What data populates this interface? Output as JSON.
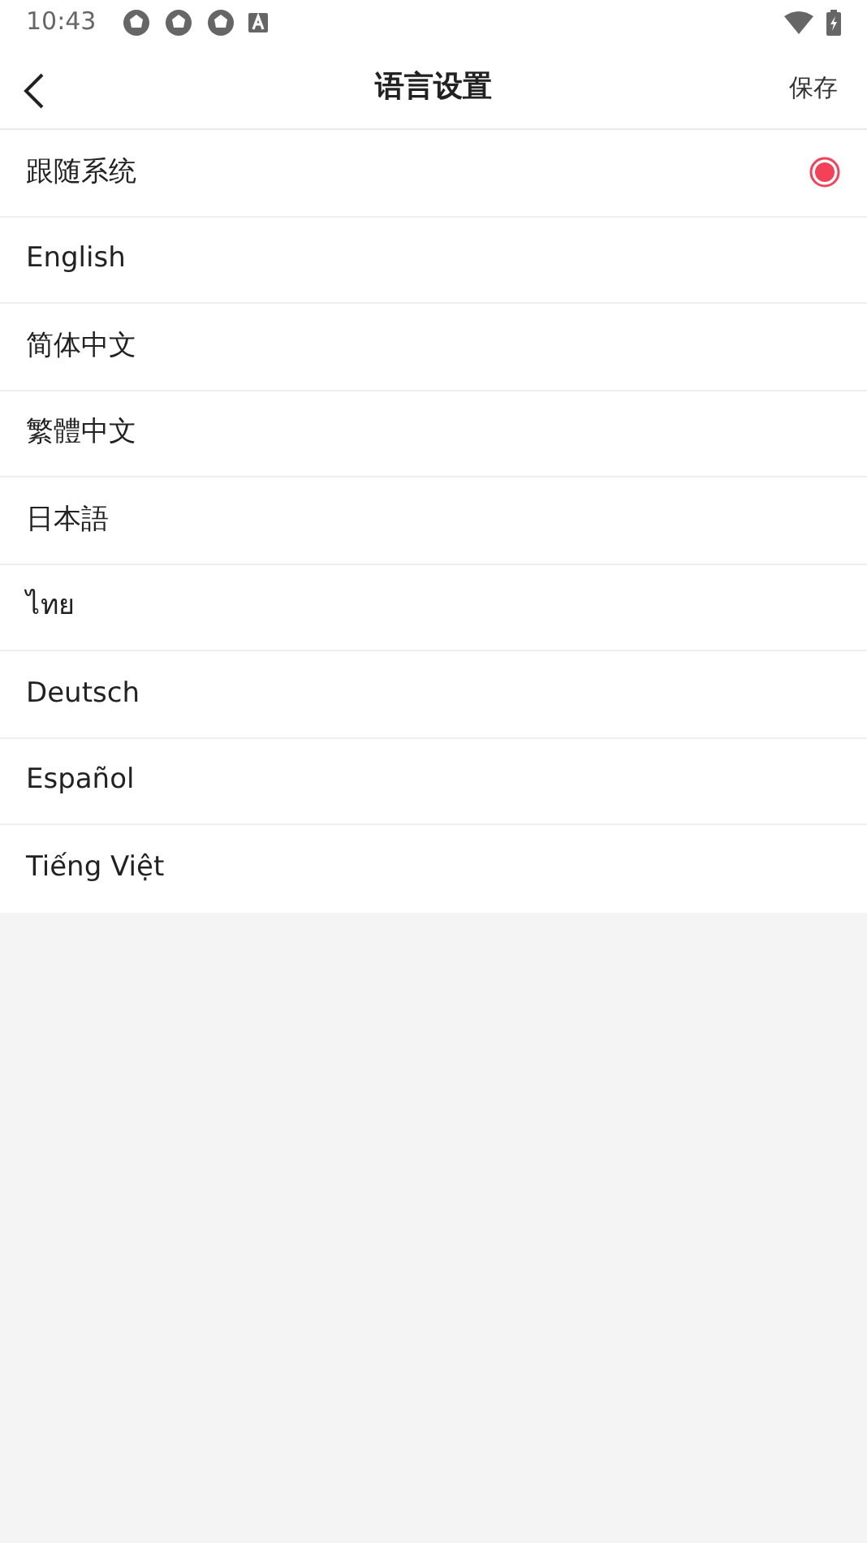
{
  "status_bar": {
    "time": "10:43"
  },
  "header": {
    "title": "语言设置",
    "action": "保存"
  },
  "languages": [
    {
      "label": "跟随系统",
      "selected": true
    },
    {
      "label": "English",
      "selected": false
    },
    {
      "label": "简体中文",
      "selected": false
    },
    {
      "label": "繁體中文",
      "selected": false
    },
    {
      "label": "日本語",
      "selected": false
    },
    {
      "label": "ไทย",
      "selected": false
    },
    {
      "label": "Deutsch",
      "selected": false
    },
    {
      "label": "Español",
      "selected": false
    },
    {
      "label": "Tiếng Việt",
      "selected": false
    }
  ]
}
